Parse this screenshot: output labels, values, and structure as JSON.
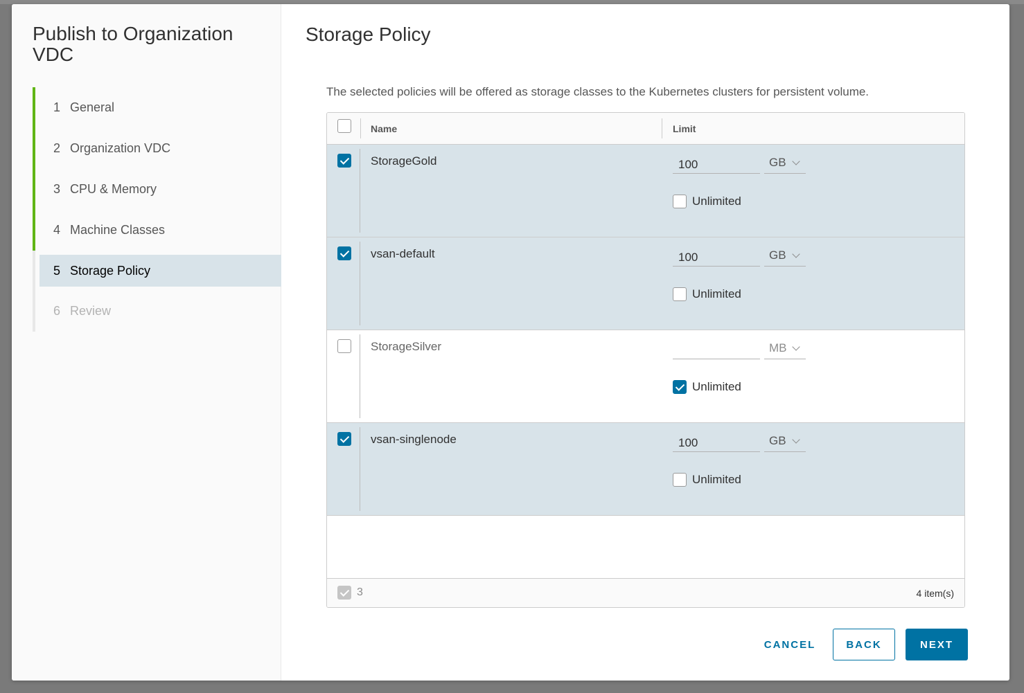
{
  "wizard": {
    "title": "Publish to Organization VDC",
    "steps": [
      {
        "num": "1",
        "label": "General",
        "state": "done"
      },
      {
        "num": "2",
        "label": "Organization VDC",
        "state": "done"
      },
      {
        "num": "3",
        "label": "CPU & Memory",
        "state": "done"
      },
      {
        "num": "4",
        "label": "Machine Classes",
        "state": "done"
      },
      {
        "num": "5",
        "label": "Storage Policy",
        "state": "active"
      },
      {
        "num": "6",
        "label": "Review",
        "state": "disabled"
      }
    ]
  },
  "page": {
    "title": "Storage Policy",
    "description": "The selected policies will be offered as storage classes to the Kubernetes clusters for persistent volume."
  },
  "grid": {
    "columns": {
      "name": "Name",
      "limit": "Limit"
    },
    "rows": [
      {
        "name": "StorageGold",
        "selected": true,
        "limit": "100",
        "unit": "GB",
        "unlimited": false,
        "unlimited_label": "Unlimited"
      },
      {
        "name": "vsan-default",
        "selected": true,
        "limit": "100",
        "unit": "GB",
        "unlimited": false,
        "unlimited_label": "Unlimited"
      },
      {
        "name": "StorageSilver",
        "selected": false,
        "limit": "",
        "unit": "MB",
        "unlimited": true,
        "unlimited_label": "Unlimited"
      },
      {
        "name": "vsan-singlenode",
        "selected": true,
        "limit": "100",
        "unit": "GB",
        "unlimited": false,
        "unlimited_label": "Unlimited"
      }
    ],
    "footer": {
      "selected_count": "3",
      "total": "4 item(s)"
    }
  },
  "buttons": {
    "cancel": "CANCEL",
    "back": "BACK",
    "next": "NEXT"
  },
  "colors": {
    "accent": "#0072a3",
    "step_done": "#60b515",
    "row_selected": "#d8e3e9"
  }
}
